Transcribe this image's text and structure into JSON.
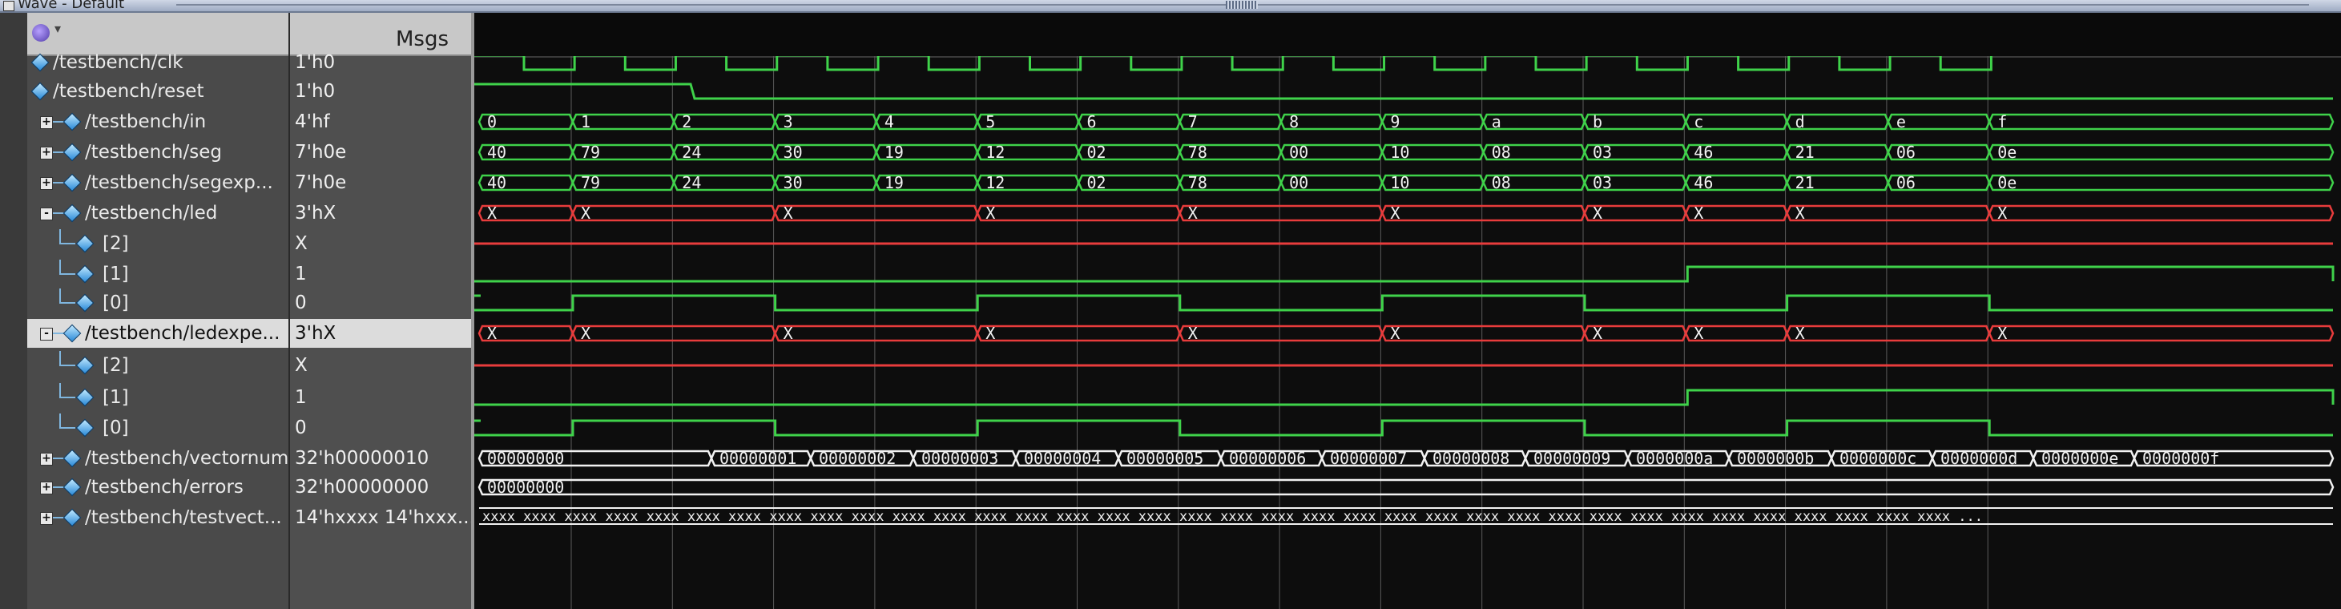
{
  "window": {
    "title": "Wave - Default"
  },
  "header": {
    "msgs_label": "Msgs"
  },
  "signals": [
    {
      "name": "/testbench/clk",
      "value": "1'h0",
      "expander": "",
      "indent": 0,
      "color": "#3fd24a"
    },
    {
      "name": "/testbench/reset",
      "value": "1'h0",
      "expander": "",
      "indent": 0,
      "color": "#3fd24a"
    },
    {
      "name": "/testbench/in",
      "value": "4'hf",
      "expander": "+",
      "indent": 0,
      "color": "#3fd24a"
    },
    {
      "name": "/testbench/seg",
      "value": "7'h0e",
      "expander": "+",
      "indent": 0,
      "color": "#3fd24a"
    },
    {
      "name": "/testbench/segexp...",
      "value": "7'h0e",
      "expander": "+",
      "indent": 0,
      "color": "#3fd24a"
    },
    {
      "name": "/testbench/led",
      "value": "3'hX",
      "expander": "-",
      "indent": 0,
      "color": "#e83c3c"
    },
    {
      "name": "[2]",
      "value": "X",
      "expander": "",
      "indent": 1,
      "color": "#e83c3c"
    },
    {
      "name": "[1]",
      "value": "1",
      "expander": "",
      "indent": 1,
      "color": "#3fd24a"
    },
    {
      "name": "[0]",
      "value": "0",
      "expander": "",
      "indent": 1,
      "color": "#3fd24a"
    },
    {
      "name": "/testbench/ledexpe...",
      "value": "3'hX",
      "expander": "-",
      "indent": 0,
      "color": "#e83c3c"
    },
    {
      "name": "[2]",
      "value": "X",
      "expander": "",
      "indent": 1,
      "color": "#e83c3c"
    },
    {
      "name": "[1]",
      "value": "1",
      "expander": "",
      "indent": 1,
      "color": "#3fd24a"
    },
    {
      "name": "[0]",
      "value": "0",
      "expander": "",
      "indent": 1,
      "color": "#3fd24a"
    },
    {
      "name": "/testbench/vectornum",
      "value": "32'h00000010",
      "expander": "+",
      "indent": 0,
      "color": "#3fd24a"
    },
    {
      "name": "/testbench/errors",
      "value": "32'h00000000",
      "expander": "+",
      "indent": 0,
      "color": "#3fd24a"
    },
    {
      "name": "/testbench/testvect...",
      "value": "14'hxxxx 14'hxxx...",
      "expander": "+",
      "indent": 0,
      "color": "#3fd24a"
    }
  ],
  "wave_labels": {
    "in": [
      "0",
      "1",
      "2",
      "3",
      "4",
      "5",
      "6",
      "7",
      "8",
      "9",
      "a",
      "b",
      "c",
      "d",
      "e",
      "f"
    ],
    "seg": [
      "40",
      "79",
      "24",
      "30",
      "19",
      "12",
      "02",
      "78",
      "00",
      "10",
      "08",
      "03",
      "46",
      "21",
      "06",
      "0e"
    ],
    "segexpected": [
      "40",
      "79",
      "24",
      "30",
      "19",
      "12",
      "02",
      "78",
      "00",
      "10",
      "08",
      "03",
      "46",
      "21",
      "06",
      "0e"
    ],
    "led": [
      "X",
      "X",
      "X",
      "X",
      "X",
      "X",
      "X",
      "X",
      "X",
      "X"
    ],
    "ledexpected": [
      "X",
      "X",
      "X",
      "X",
      "X",
      "X",
      "X",
      "X",
      "X",
      "X"
    ],
    "vectornum": [
      "00000000",
      "00000001",
      "00000002",
      "00000003",
      "00000004",
      "00000005",
      "00000006",
      "00000007",
      "00000008",
      "00000009",
      "0000000a",
      "0000000b",
      "0000000c",
      "0000000d",
      "0000000e",
      "0000000f"
    ],
    "errors": [
      "00000000"
    ],
    "testvectors": "xxxx xxxx xxxx xxxx xxxx xxxx xxxx xxxx xxxx xxxx xxxx xxxx xxxx xxxx xxxx xxxx xxxx xxxx xxxx xxxx xxxx xxxx xxxx xxxx xxxx xxxx xxxx xxxx xxxx xxxx xxxx xxxx xxxx xxxx xxxx xxxx ..."
  },
  "colors": {
    "green": "#3fd24a",
    "red": "#e83c3c",
    "white": "#f2f2f2",
    "gridline": "#5a5a5a",
    "background": "#0d0d0d"
  }
}
